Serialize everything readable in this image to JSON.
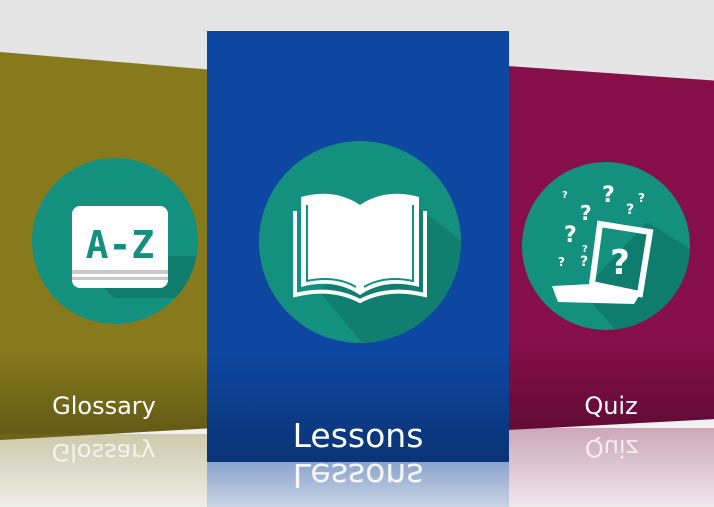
{
  "cards": [
    {
      "label": "Glossary",
      "icon": "a-z-book-icon",
      "color": "#867a1c"
    },
    {
      "label": "Lessons",
      "icon": "open-book-icon",
      "color": "#0d47a1"
    },
    {
      "label": "Quiz",
      "icon": "question-laptop-icon",
      "color": "#860f49"
    }
  ],
  "icon_circle_color": "#14907f",
  "glossary_icon_text": "A-Z"
}
